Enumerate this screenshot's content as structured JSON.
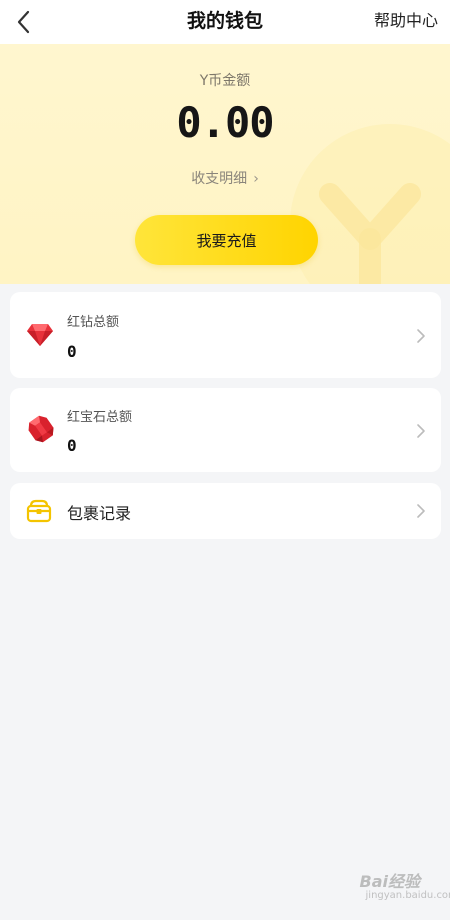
{
  "header": {
    "title": "我的钱包",
    "help_label": "帮助中心",
    "back_icon": "back-arrow-icon"
  },
  "wallet": {
    "coin_label": "Y币金额",
    "coin_balance": "0.00",
    "detail_link": "收支明细",
    "recharge_label": "我要充值"
  },
  "cards": [
    {
      "label": "红钻总额",
      "value": "0",
      "icon": "red-diamond-icon"
    },
    {
      "label": "红宝石总额",
      "value": "0",
      "icon": "ruby-icon"
    },
    {
      "label": "包裹记录",
      "icon": "package-icon"
    }
  ],
  "watermark": {
    "brand": "Bai经验",
    "url": "jingyan.baidu.com"
  },
  "colors": {
    "accent": "#ffd400",
    "hero_bg": "#fff6cf",
    "page_bg": "#f4f5f7"
  }
}
